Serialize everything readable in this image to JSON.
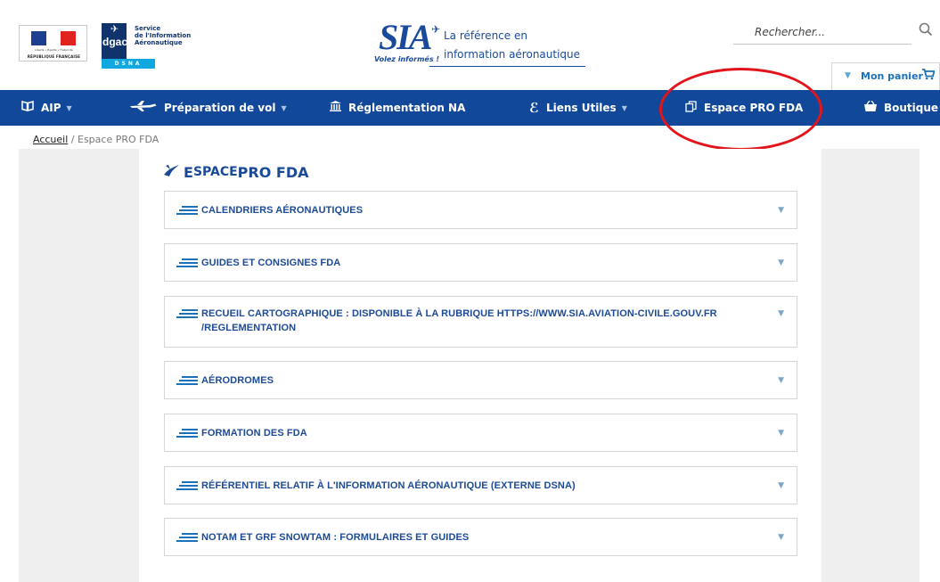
{
  "header": {
    "rf_small": "Liberté • Égalité • Fraternité",
    "rf_text": "RÉPUBLIQUE FRANÇAISE",
    "dgac_word": "dgac",
    "dgac_line1": "Service",
    "dgac_line2": "de l'Information",
    "dgac_line3": "Aéronautique",
    "dsna": "DSNA",
    "sia_word": "SIA",
    "sia_tagline": "Volez informés !",
    "sia_ref_line1": "La référence en",
    "sia_ref_line2": "information aéronautique",
    "search_placeholder": "Rechercher...",
    "cart_label": "Mon panier"
  },
  "nav": {
    "items": [
      {
        "label": "AIP",
        "icon": "book-icon",
        "caret": true
      },
      {
        "label": "Préparation de vol",
        "icon": "airplane-icon",
        "caret": true
      },
      {
        "label": "Réglementation NA",
        "icon": "institution-icon",
        "caret": false
      },
      {
        "label": "Liens Utiles",
        "icon": "link-icon",
        "caret": true
      },
      {
        "label": "Espace PRO FDA",
        "icon": "copy-icon",
        "caret": false
      },
      {
        "label": "Boutique",
        "icon": "basket-icon",
        "caret": false
      }
    ]
  },
  "breadcrumb": {
    "home": "Accueil",
    "separator": "/",
    "current": "Espace PRO FDA"
  },
  "page": {
    "title_first": "E",
    "title_rest_small": "SPACE",
    "title_rest": " PRO FDA",
    "sections": [
      {
        "title": "CALENDRIERS AÉRONAUTIQUES"
      },
      {
        "title": "GUIDES ET CONSIGNES FDA"
      },
      {
        "title": "RECUEIL CARTOGRAPHIQUE : DISPONIBLE À LA RUBRIQUE HTTPS://WWW.SIA.AVIATION-CIVILE.GOUV.FR",
        "title_line2": "/REGLEMENTATION"
      },
      {
        "title": "AÉRODROMES"
      },
      {
        "title": "FORMATION DES FDA"
      },
      {
        "title": "RÉFÉRENTIEL RELATIF À L'INFORMATION AÉRONAUTIQUE (EXTERNE DSNA)"
      },
      {
        "title": "NOTAM ET GRF SNOWTAM : FORMULAIRES ET GUIDES"
      }
    ]
  },
  "colors": {
    "nav_bg": "#11489a",
    "accent": "#1c72b8",
    "highlight_circle": "#e3141b",
    "sidebar_bg": "#efefef"
  }
}
